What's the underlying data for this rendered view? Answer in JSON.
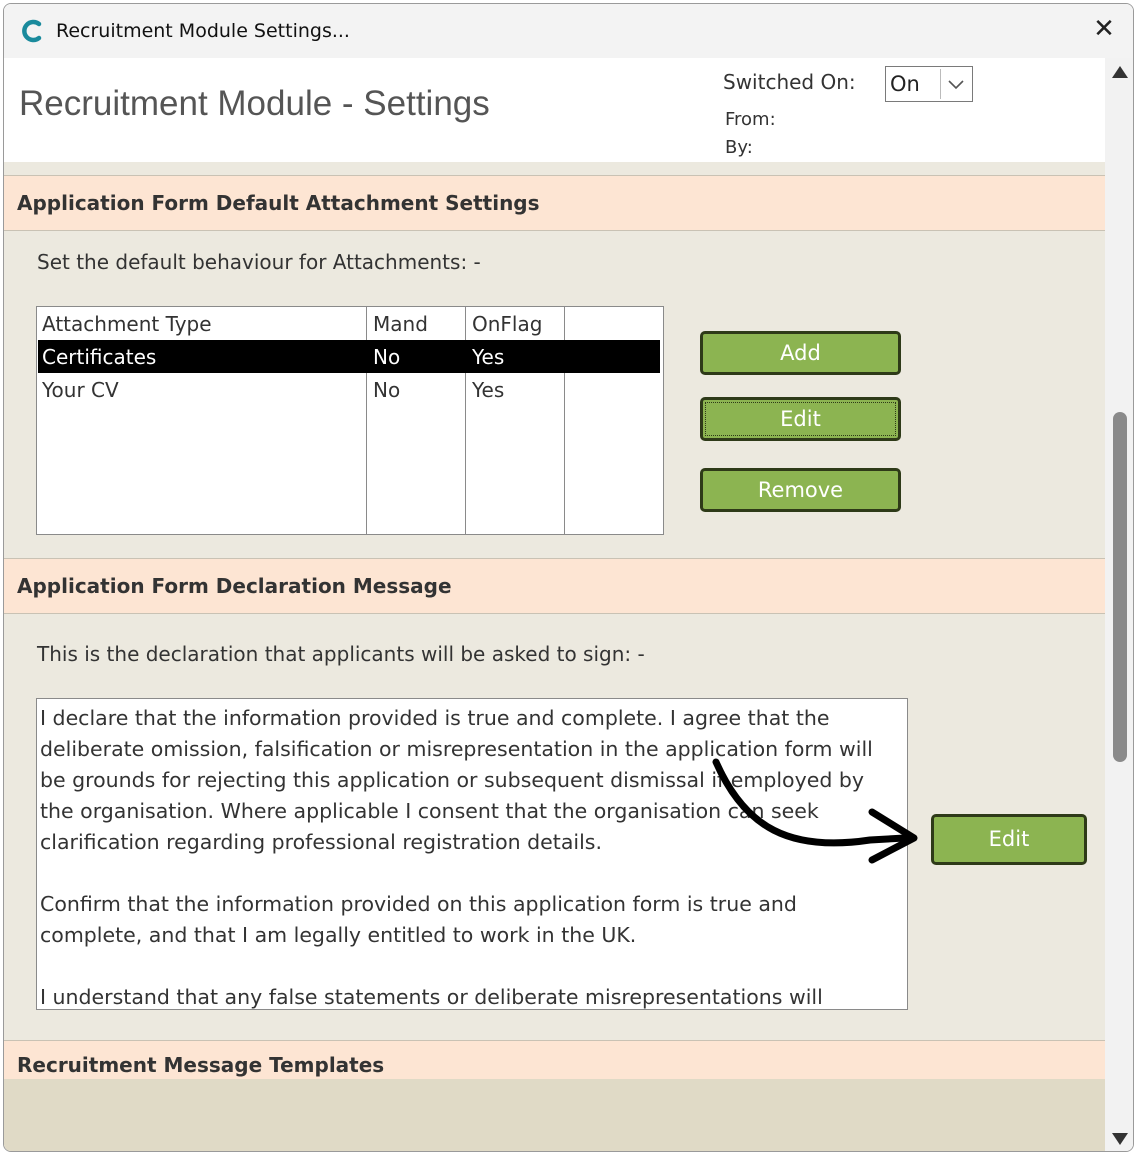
{
  "window": {
    "title": "Recruitment Module Settings...",
    "close_label": "✕"
  },
  "header": {
    "page_title": "Recruitment Module - Settings",
    "switched_on_label": "Switched On:",
    "switched_on_value": "On",
    "from_label": "From:",
    "by_label": "By:"
  },
  "attachments": {
    "section_title": "Application Form Default Attachment Settings",
    "description": "Set the default behaviour for Attachments: -",
    "columns": [
      "Attachment Type",
      "Mand",
      "OnFlag"
    ],
    "rows": [
      {
        "type": "Certificates",
        "mand": "No",
        "onflag": "Yes",
        "selected": true
      },
      {
        "type": "Your CV",
        "mand": "No",
        "onflag": "Yes",
        "selected": false
      }
    ],
    "add_label": "Add",
    "edit_label": "Edit",
    "remove_label": "Remove"
  },
  "declaration": {
    "section_title": "Application Form Declaration Message",
    "description": "This is the declaration that applicants will be asked to sign: -",
    "paragraphs": [
      "I declare that the information provided is true and complete. I agree that the deliberate omission, falsification or misrepresentation in the application form will be grounds for rejecting this application or subsequent dismissal if employed by the organisation. Where applicable I consent that the organisation can seek clarification regarding professional registration details.",
      "Confirm that the information provided on this application form is true and complete, and that I am legally entitled to work in the UK.",
      "I understand that any false statements or deliberate misrepresentations will"
    ],
    "edit_label": "Edit"
  },
  "templates": {
    "section_title": "Recruitment Message Templates"
  },
  "colors": {
    "button_green": "#8cb451",
    "section_bg": "#fde5d3",
    "panel_bg": "#ece9df",
    "app_icon": "#1a8a9c"
  },
  "icons": {
    "app": "app-logo-c-icon",
    "close": "close-icon",
    "dropdown": "chevron-down-icon",
    "scroll_up": "scroll-up-arrow-icon",
    "scroll_down": "scroll-down-arrow-icon",
    "annotation": "curved-arrow-icon"
  }
}
